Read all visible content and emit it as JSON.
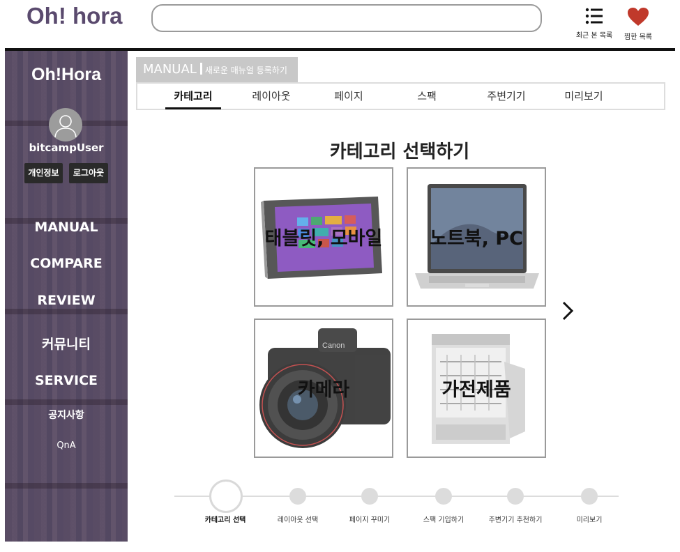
{
  "header": {
    "logo": "Oh! hora",
    "search_placeholder": "",
    "recent_label": "최근 본 목록",
    "wishlist_label": "찜한 목록",
    "heart_color": "#c0392b"
  },
  "sidebar": {
    "title": "Oh!Hora",
    "username": "bitcampUser",
    "profile_button": "개인정보",
    "logout_button": "로그아웃",
    "nav": [
      "MANUAL",
      "COMPARE",
      "REVIEW",
      "커뮤니티",
      "SERVICE",
      "공지사항",
      "QnA"
    ]
  },
  "manual": {
    "tag": "MANUAL",
    "subtitle": "새로운 매뉴얼 등록하기"
  },
  "tabs": [
    "카테고리",
    "레이아웃",
    "페이지",
    "스팩",
    "주변기기",
    "미리보기"
  ],
  "active_tab": "카테고리",
  "category": {
    "title": "카테고리 선택하기",
    "cards": [
      {
        "label": "태블릿, 모바일",
        "icon": "tablet-image"
      },
      {
        "label": "노트북, PC",
        "icon": "laptop-image"
      },
      {
        "label": "카메라",
        "icon": "camera-image"
      },
      {
        "label": "가전제품",
        "icon": "dishwasher-image"
      }
    ],
    "next_icon": "chevron-right-icon"
  },
  "steps": [
    "카테고리 선택",
    "레이아웃 선택",
    "페이지 꾸미기",
    "스팩 기입하기",
    "주변기기 추천하기",
    "미리보기"
  ],
  "active_step": "카테고리 선택"
}
